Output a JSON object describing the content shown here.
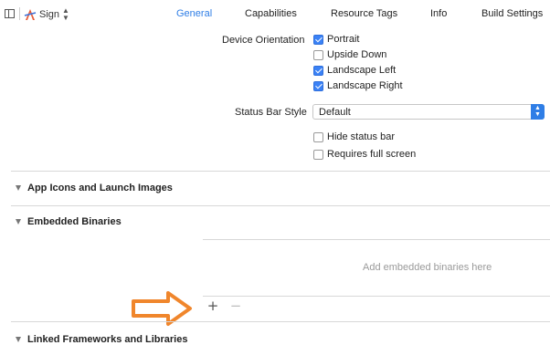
{
  "header": {
    "target_name": "Sign",
    "tabs": [
      {
        "label": "General",
        "active": true
      },
      {
        "label": "Capabilities",
        "active": false
      },
      {
        "label": "Resource Tags",
        "active": false
      },
      {
        "label": "Info",
        "active": false
      },
      {
        "label": "Build Settings",
        "active": false
      }
    ]
  },
  "deployment": {
    "device_orientation_label": "Device Orientation",
    "orientations": [
      {
        "label": "Portrait",
        "checked": true
      },
      {
        "label": "Upside Down",
        "checked": false
      },
      {
        "label": "Landscape Left",
        "checked": true
      },
      {
        "label": "Landscape Right",
        "checked": true
      }
    ],
    "status_bar_style_label": "Status Bar Style",
    "status_bar_style_value": "Default",
    "options": [
      {
        "label": "Hide status bar",
        "checked": false
      },
      {
        "label": "Requires full screen",
        "checked": false
      }
    ]
  },
  "sections": {
    "app_icons": "App Icons and Launch Images",
    "embedded_binaries": "Embedded Binaries",
    "embedded_placeholder": "Add embedded binaries here",
    "linked_frameworks": "Linked Frameworks and Libraries"
  },
  "controls": {
    "add_symbol": "+",
    "remove_symbol": "−"
  },
  "colors": {
    "accent": "#2f7ee6",
    "annotation_arrow": "#f0862c"
  },
  "icons": {
    "sidebar_toggle": "sidebar-toggle-icon",
    "app": "app-icon",
    "disclosure": "disclosure-triangle-icon",
    "annotation": "arrow-right-icon"
  }
}
